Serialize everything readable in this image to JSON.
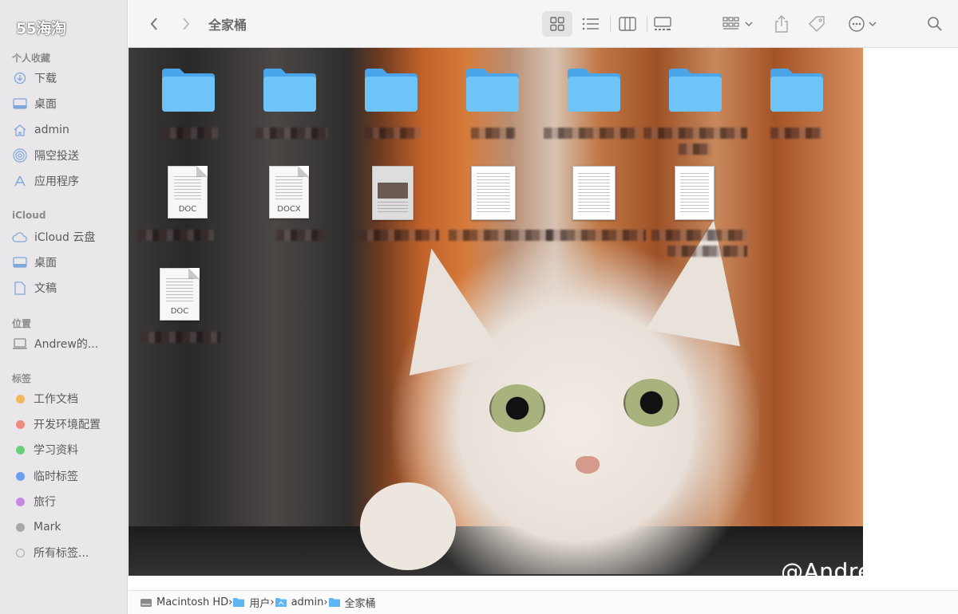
{
  "brand": "55海淘",
  "sidebar": {
    "sections": [
      {
        "header": "个人收藏",
        "items": [
          {
            "label": "下载",
            "icon": "download-icon"
          },
          {
            "label": "桌面",
            "icon": "desktop-icon"
          },
          {
            "label": "admin",
            "icon": "home-icon"
          },
          {
            "label": "隔空投送",
            "icon": "airdrop-icon"
          },
          {
            "label": "应用程序",
            "icon": "applications-icon"
          }
        ]
      },
      {
        "header": "iCloud",
        "items": [
          {
            "label": "iCloud 云盘",
            "icon": "cloud-icon"
          },
          {
            "label": "桌面",
            "icon": "desktop-icon"
          },
          {
            "label": "文稿",
            "icon": "document-icon"
          }
        ]
      },
      {
        "header": "位置",
        "items": [
          {
            "label": "Andrew的...",
            "icon": "laptop-icon"
          }
        ]
      },
      {
        "header": "标签",
        "tags": [
          {
            "label": "工作文档",
            "color": "#f0b95e"
          },
          {
            "label": "开发环境配置",
            "color": "#f08a7c"
          },
          {
            "label": "学习资料",
            "color": "#6bcf7a"
          },
          {
            "label": "临时标签",
            "color": "#6b9ff0"
          },
          {
            "label": "旅行",
            "color": "#c28be0"
          },
          {
            "label": "Mark",
            "color": "#a9a8aa"
          },
          {
            "label": "所有标签...",
            "color": "outline"
          }
        ]
      }
    ]
  },
  "toolbar": {
    "title": "全家桶"
  },
  "files": {
    "row2_exts": [
      "DOC",
      "DOCX"
    ],
    "row3_ext": "DOC"
  },
  "watermark": "@AndrewXue",
  "pathbar": {
    "crumbs": [
      "Macintosh HD",
      "用户",
      "admin",
      "全家桶"
    ]
  }
}
